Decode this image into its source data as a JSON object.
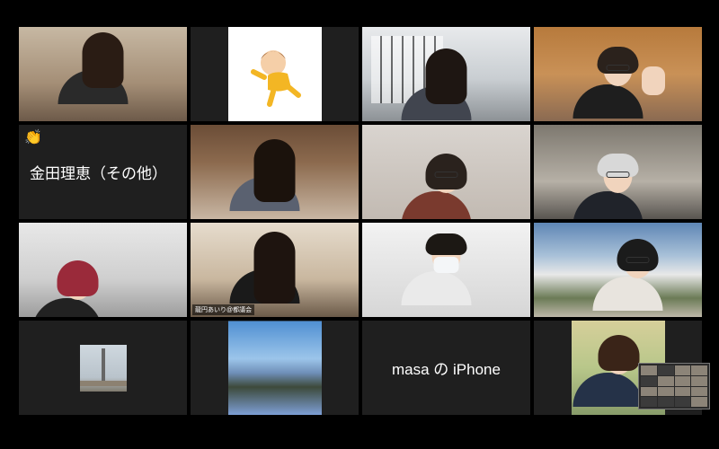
{
  "app": "Video conference gallery view",
  "tiles": [
    {
      "kind": "video",
      "caption": ""
    },
    {
      "kind": "avatar",
      "avatar": "cartoon-character-icon"
    },
    {
      "kind": "video",
      "caption": ""
    },
    {
      "kind": "video",
      "caption": ""
    },
    {
      "kind": "name",
      "name": "金田理恵（その他）",
      "reaction": "👏"
    },
    {
      "kind": "video",
      "caption": ""
    },
    {
      "kind": "video",
      "caption": ""
    },
    {
      "kind": "video",
      "caption": ""
    },
    {
      "kind": "video",
      "caption": ""
    },
    {
      "kind": "video",
      "caption": "龍円あいり@都議会"
    },
    {
      "kind": "video",
      "caption": ""
    },
    {
      "kind": "video",
      "caption": ""
    },
    {
      "kind": "avatar",
      "avatar": "tower-photo"
    },
    {
      "kind": "avatar",
      "avatar": "flower-field-photo"
    },
    {
      "kind": "name",
      "name": "masa の iPhone"
    },
    {
      "kind": "video",
      "caption": ""
    }
  ],
  "colors": {
    "background": "#000000",
    "tile": "#1c1c1c",
    "active_speaker_border": "#e9d84a",
    "name_text": "#ffffff"
  }
}
